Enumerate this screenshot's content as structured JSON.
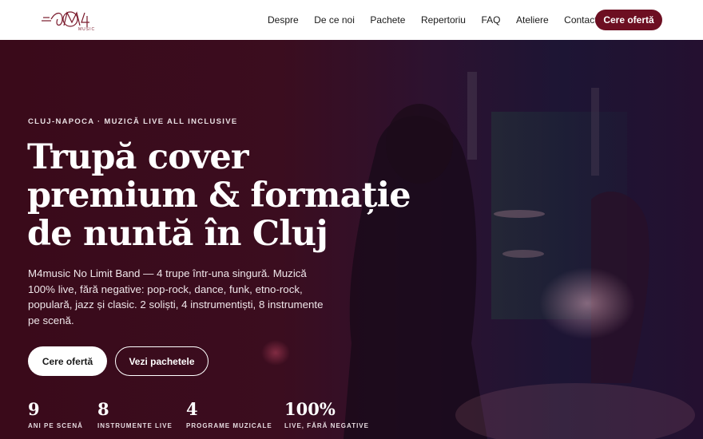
{
  "brand": {
    "logo_text": "M4",
    "logo_sub": "MUSIC",
    "accent": "#6d0f22"
  },
  "nav": {
    "items": [
      {
        "label": "Despre"
      },
      {
        "label": "De ce noi"
      },
      {
        "label": "Pachete"
      },
      {
        "label": "Repertoriu"
      },
      {
        "label": "FAQ"
      },
      {
        "label": "Ateliere"
      },
      {
        "label": "Contact"
      }
    ],
    "cta_label": "Cere ofertă"
  },
  "hero": {
    "eyebrow": "CLUJ-NAPOCA · MUZICĂ LIVE ALL INCLUSIVE",
    "title": "Trupă cover premium & formație de nuntă în Cluj",
    "description": "M4music No Limit Band — 4 trupe într-una singură. Muzică 100% live, fără negative: pop-rock, dance, funk, etno-rock, populară, jazz și clasic. 2 soliști, 4 instrumentiști, 8 instrumente pe scenă.",
    "primary_button": "Cere ofertă",
    "secondary_button": "Vezi pachetele",
    "stats": [
      {
        "value": "9",
        "label": "ANI PE SCENĂ"
      },
      {
        "value": "8",
        "label": "INSTRUMENTE LIVE"
      },
      {
        "value": "4",
        "label": "PROGRAME MUZICALE"
      },
      {
        "value": "100%",
        "label": "LIVE, FĂRĂ NEGATIVE"
      }
    ]
  }
}
